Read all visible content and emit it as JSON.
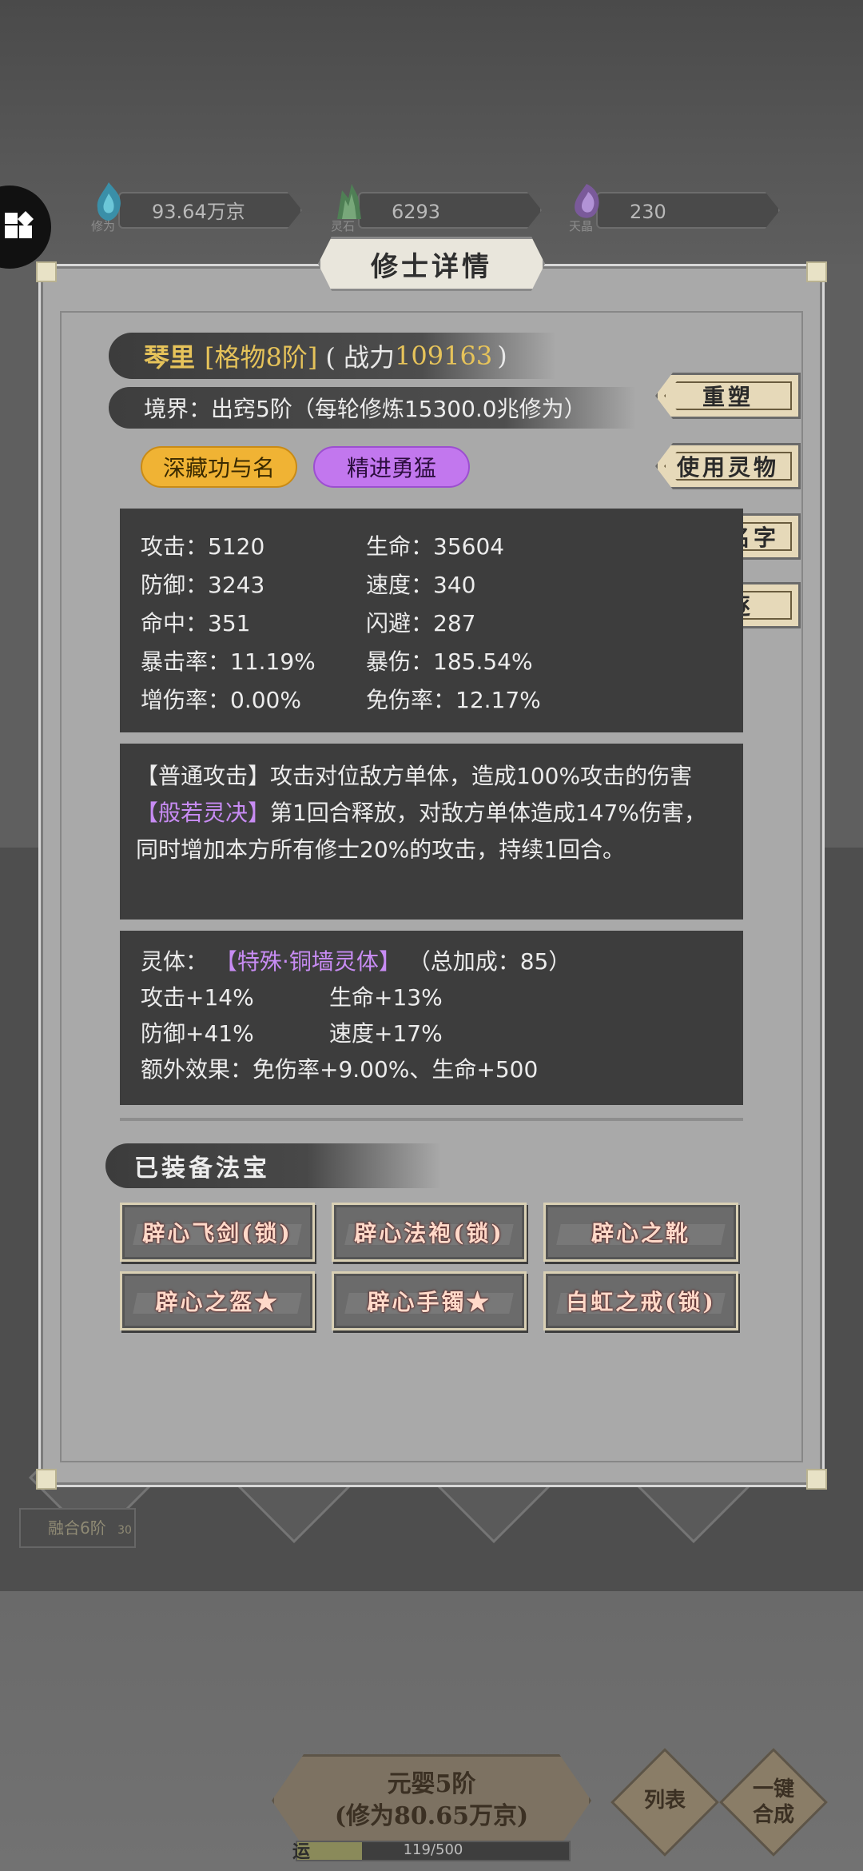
{
  "resources": [
    {
      "icon": "cultivation-gem-icon",
      "caption": "修为",
      "value": "93.64万京"
    },
    {
      "icon": "spirit-stone-icon",
      "caption": "灵石",
      "value": "6293"
    },
    {
      "icon": "sky-crystal-icon",
      "caption": "天晶",
      "value": "230"
    }
  ],
  "dialog": {
    "title": "修士详情",
    "name": "琴里",
    "rank": "[格物8阶]",
    "power_prefix": "( 战力",
    "power_value": "109163",
    "power_suffix": ")",
    "realm": "境界：出窍5阶（每轮修炼15300.0兆修为）",
    "tags": [
      "深藏功与名",
      "精进勇猛"
    ],
    "actions": [
      "重塑",
      "使用灵物",
      "修改名字",
      "驱逐"
    ],
    "stats": [
      [
        "攻击：5120",
        "生命：35604"
      ],
      [
        "防御：3243",
        "速度：340"
      ],
      [
        "命中：351",
        "闪避：287"
      ],
      [
        "暴击率：11.19%",
        "暴伤：185.54%"
      ],
      [
        "增伤率：0.00%",
        "免伤率：12.17%"
      ]
    ],
    "skill1_name": "【普通攻击】",
    "skill1_text": "攻击对位敌方单体，造成100%攻击的伤害",
    "skill2_name": "【般若灵决】",
    "skill2_text": "第1回合释放，对敌方单体造成147%伤害，同时增加本方所有修士20%的攻击，持续1回合。",
    "spirit_body_label": "灵体：",
    "spirit_body_name": "【特殊·铜墙灵体】",
    "spirit_body_total": "（总加成：85）",
    "spirit_body_stats": [
      [
        "攻击+14%",
        "生命+13%"
      ],
      [
        "防御+41%",
        "速度+17%"
      ]
    ],
    "extra_effect": "额外效果：免伤率+9.00%、生命+500",
    "equipped_header": "已装备法宝",
    "equipment": [
      "辟心飞剑(锁)",
      "辟心法袍(锁)",
      "辟心之靴",
      "辟心之盔★",
      "辟心手镯★",
      "白虹之戒(锁)"
    ]
  },
  "background": {
    "card_label": "融合6阶",
    "card_number": "30",
    "main_button_line1": "元婴5阶",
    "main_button_line2": "(修为80.65万京)",
    "list_button": "列表",
    "merge_button_line1": "一键",
    "merge_button_line2": "合成",
    "luck_label": "运",
    "luck_value": "119/500",
    "luck_fraction": 0.238
  }
}
